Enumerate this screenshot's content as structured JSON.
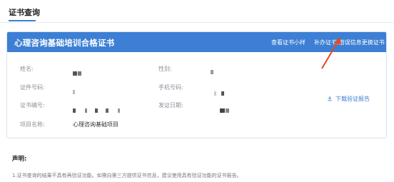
{
  "page": {
    "tab": "证书查询"
  },
  "card": {
    "title": "心理咨询基础培训合格证书",
    "view_sample": "查看证书小样",
    "reissue": "补办证书/勘误信息更换证书"
  },
  "fields": {
    "name_label": "姓名:",
    "gender_label": "性别:",
    "cert_number_label": "证件号码:",
    "phone_label": "手机号码:",
    "cert_serial_label": "证书编号:",
    "issue_date_label": "发证日期:",
    "project_label": "项目名称:",
    "project_value": "心理咨询基础项目"
  },
  "download_report": "下载验证报告",
  "statement": {
    "title": "声明:",
    "line1": "1.证书查询的结果不具有再验证功能。如需向第三方提供证书信息，建议使用具有验证功能的证书报告。"
  },
  "colors": {
    "primary": "#3c7fd4",
    "annotation_arrow": "#e8481e"
  },
  "icons": {
    "download": "download-icon"
  }
}
